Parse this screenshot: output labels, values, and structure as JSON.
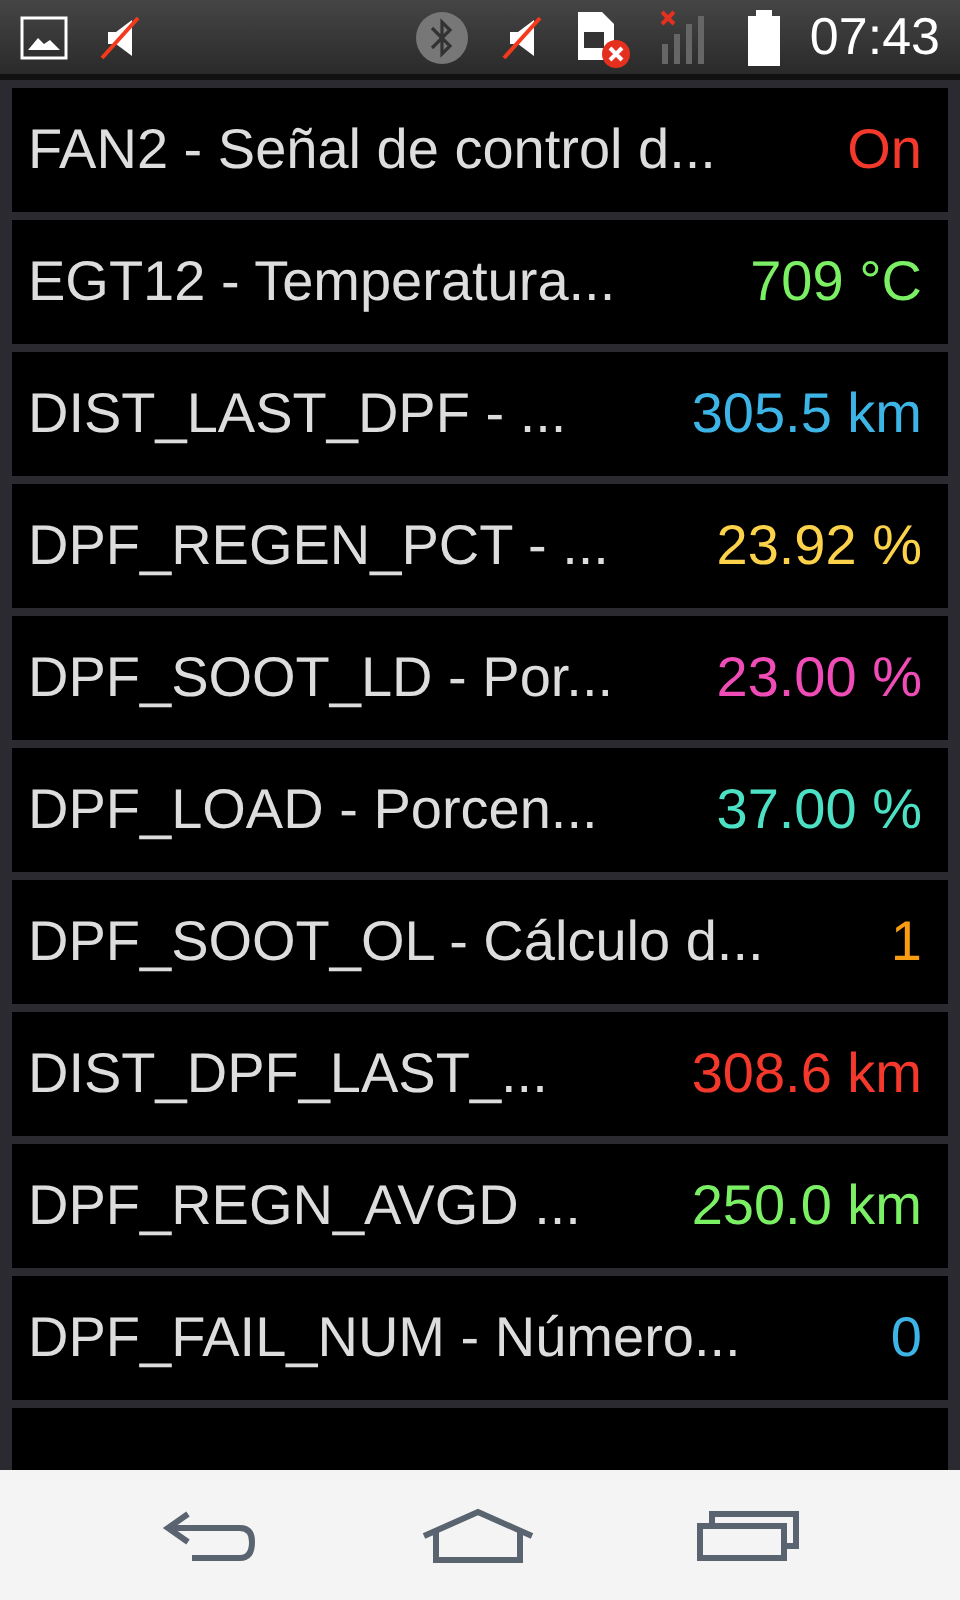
{
  "status_bar": {
    "time": "07:43"
  },
  "readings": [
    {
      "name": "FAN2 - Señal de control d...",
      "value": "On",
      "color": "#f4392c"
    },
    {
      "name": "EGT12 - Temperatura...",
      "value": "709 °C",
      "color": "#7cf064"
    },
    {
      "name": "DIST_LAST_DPF - ...",
      "value": "305.5 km",
      "color": "#3cb4e6"
    },
    {
      "name": "DPF_REGEN_PCT - ...",
      "value": "23.92 %",
      "color": "#fcd24a"
    },
    {
      "name": "DPF_SOOT_LD - Por...",
      "value": "23.00 %",
      "color": "#f04cb8"
    },
    {
      "name": "DPF_LOAD - Porcen...",
      "value": "37.00 %",
      "color": "#4ce0c4"
    },
    {
      "name": "DPF_SOOT_OL - Cálculo d...",
      "value": "1",
      "color": "#f89c14"
    },
    {
      "name": "DIST_DPF_LAST_...",
      "value": "308.6 km",
      "color": "#f4392c"
    },
    {
      "name": "DPF_REGN_AVGD ...",
      "value": "250.0 km",
      "color": "#7cf064"
    },
    {
      "name": "DPF_FAIL_NUM - Número...",
      "value": "0",
      "color": "#3cb4e6"
    }
  ]
}
